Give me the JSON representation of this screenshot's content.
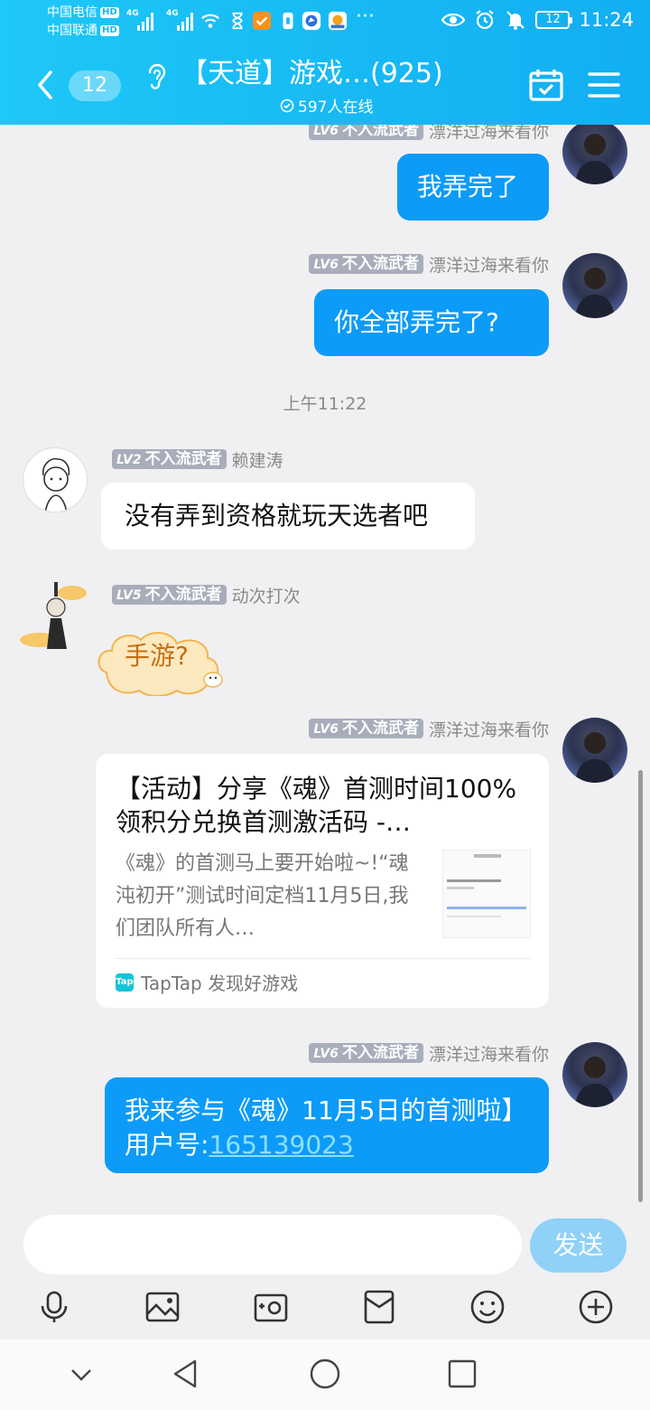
{
  "status_bar": {
    "carrier1": "中国电信",
    "carrier2": "中国联通",
    "hd": "HD",
    "net1": "4G",
    "net2": "4G",
    "battery": "12",
    "time": "11:24",
    "more": "···"
  },
  "header": {
    "unread_count": "12",
    "title": "【天道】游戏…(925)",
    "online": "597人在线"
  },
  "messages": [
    {
      "level": "LV6",
      "badge": "不入流武者",
      "sender": "漂洋过海来看你",
      "text": "我弄完了"
    },
    {
      "level": "LV6",
      "badge": "不入流武者",
      "sender": "漂洋过海来看你",
      "text": "你全部弄完了?"
    },
    {
      "time": "上午11:22"
    },
    {
      "level": "LV2",
      "badge": "不入流武者",
      "sender": "赖建涛",
      "text": "没有弄到资格就玩天选者吧"
    },
    {
      "level": "LV5",
      "badge": "不入流武者",
      "sender": "动次打次",
      "sticker_text": "手游?"
    },
    {
      "level": "LV6",
      "badge": "不入流武者",
      "sender": "漂洋过海来看你",
      "card": {
        "title": "【活动】分享《魂》首测时间100%领积分兑换首测激活码 -…",
        "desc": "《魂》的首测马上要开始啦~!“魂沌初开”测试时间定档11月5日,我们团队所有人…",
        "source": "TapTap 发现好游戏",
        "logo": "Tap"
      }
    },
    {
      "level": "LV6",
      "badge": "不入流武者",
      "sender": "漂洋过海来看你",
      "text": "我来参与《魂》11月5日的首测啦】 用户号:",
      "link": "165139023"
    }
  ],
  "input": {
    "placeholder": "",
    "send_label": "发送"
  },
  "colors": {
    "header": "#17b9f4",
    "bubble_self": "#0c9bf8",
    "send": "#8fd1f7",
    "level_tag": "#a9adbb"
  },
  "toolbar_icons": [
    "microphone-icon",
    "image-icon",
    "camera-icon",
    "red-packet-icon",
    "emoji-icon",
    "plus-icon"
  ],
  "nav_icons": [
    "collapse-icon",
    "back-icon",
    "home-icon",
    "recents-icon"
  ]
}
